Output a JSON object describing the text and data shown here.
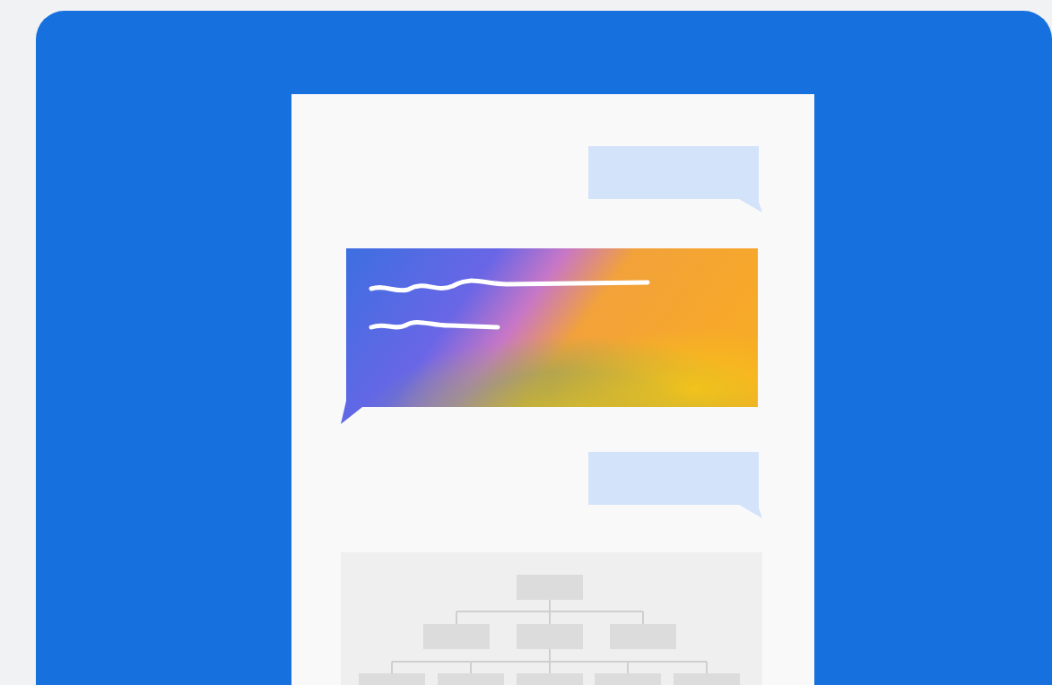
{
  "chat_messages": [
    {
      "kind": "sent"
    },
    {
      "kind": "highlight"
    },
    {
      "kind": "sent"
    }
  ]
}
